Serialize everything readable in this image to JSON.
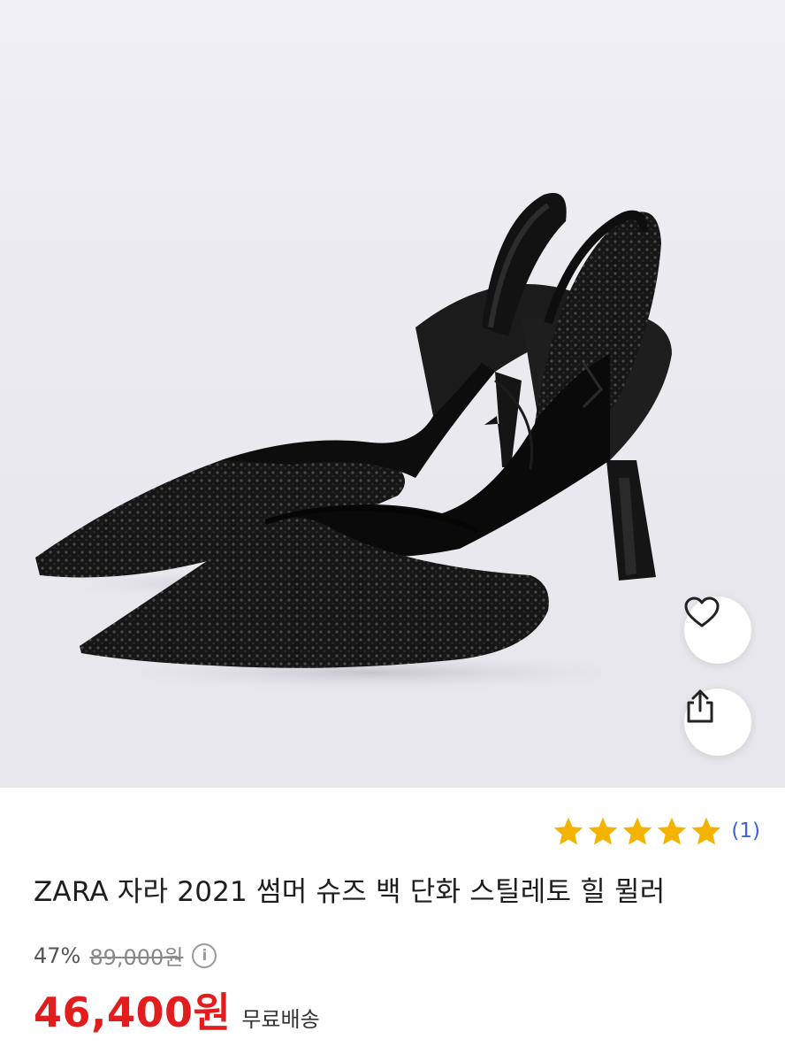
{
  "product": {
    "title": "ZARA 자라 2021 썸머 슈즈 백 단화 스틸레토 힐 뮐러",
    "image_alt": "black rhinestone slingback stiletto heels",
    "rating": {
      "stars": 5,
      "max_stars": 5,
      "count_label": "(1)",
      "star_color": "#f5b301"
    },
    "discount": "47%",
    "original_price": "89,000원",
    "sale_price": "46,400원",
    "shipping": "무료배송",
    "price_color": "#e11d1d"
  },
  "actions": {
    "like_icon": "heart-icon",
    "share_icon": "share-icon"
  }
}
